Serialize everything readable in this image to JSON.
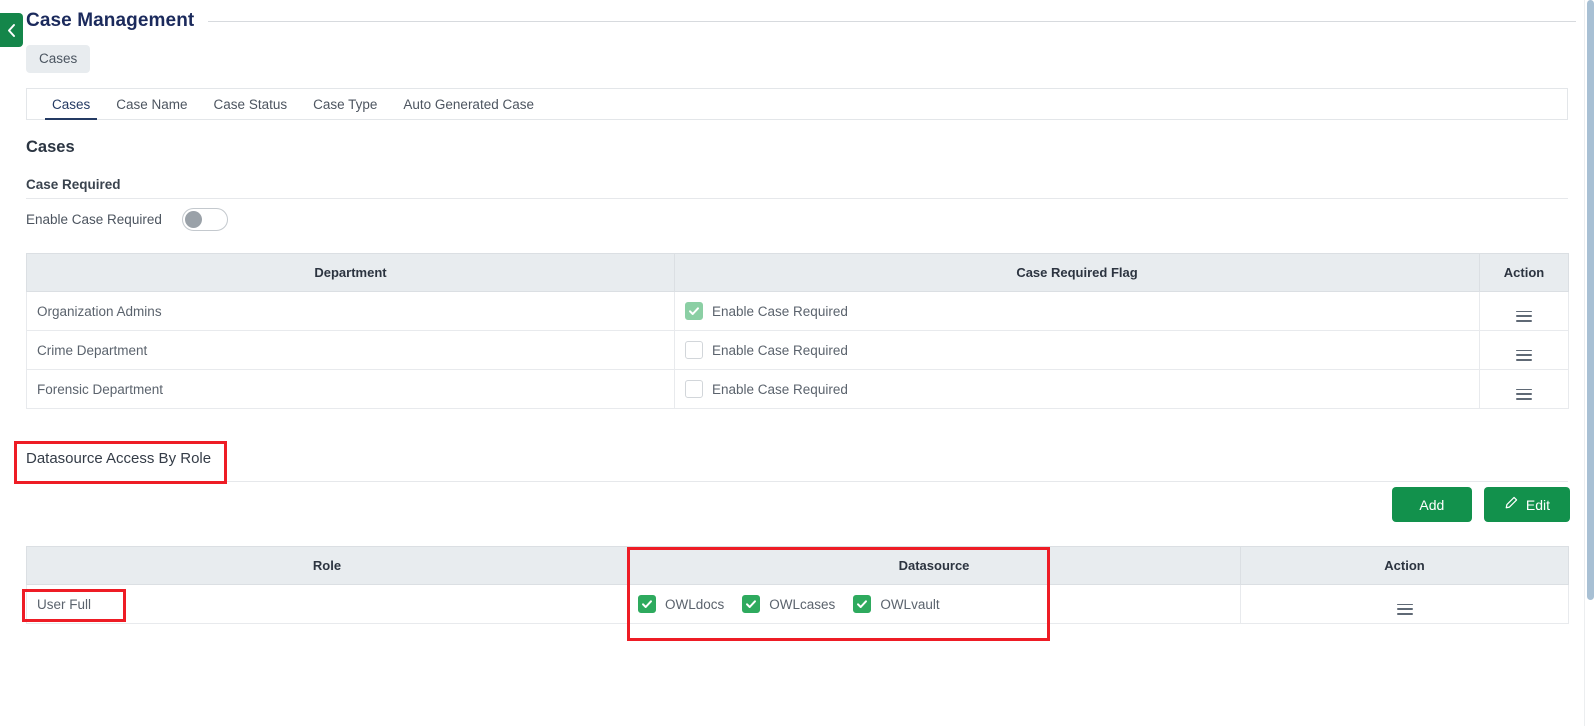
{
  "header": {
    "title": "Case Management",
    "back_icon": "chevron-left-icon",
    "accent_green": "#14864a",
    "title_color": "#1b2a5c"
  },
  "breadcrumb": {
    "items": [
      "Cases"
    ]
  },
  "tabs": [
    {
      "label": "Cases",
      "active": true
    },
    {
      "label": "Case Name",
      "active": false
    },
    {
      "label": "Case Status",
      "active": false
    },
    {
      "label": "Case Type",
      "active": false
    },
    {
      "label": "Auto Generated Case",
      "active": false
    }
  ],
  "cases_section": {
    "title": "Cases",
    "subtitle": "Case Required",
    "toggle": {
      "label": "Enable Case Required",
      "checked": false
    },
    "table": {
      "columns": [
        "Department",
        "Case Required Flag",
        "Action"
      ],
      "rows": [
        {
          "department": "Organization Admins",
          "flag_label": "Enable Case Required",
          "flag_checked": true,
          "action_icon": "hamburger-menu-icon"
        },
        {
          "department": "Crime Department",
          "flag_label": "Enable Case Required",
          "flag_checked": false,
          "action_icon": "hamburger-menu-icon"
        },
        {
          "department": "Forensic Department",
          "flag_label": "Enable Case Required",
          "flag_checked": false,
          "action_icon": "hamburger-menu-icon"
        }
      ]
    }
  },
  "datasource_section": {
    "title": "Datasource Access By Role",
    "buttons": [
      {
        "label": "Add",
        "icon": null,
        "color": "#12914c"
      },
      {
        "label": "Edit",
        "icon": "pencil-icon",
        "color": "#12914c"
      }
    ],
    "table": {
      "columns": [
        "Role",
        "Datasource",
        "Action"
      ],
      "rows": [
        {
          "role": "User Full",
          "datasources": [
            {
              "label": "OWLdocs",
              "checked": true
            },
            {
              "label": "OWLcases",
              "checked": true
            },
            {
              "label": "OWLvault",
              "checked": true
            }
          ],
          "action_icon": "hamburger-menu-icon"
        }
      ]
    }
  },
  "annotations": {
    "color": "#ee1c25",
    "boxes": [
      {
        "target": "datasource-section-title"
      },
      {
        "target": "role-cell-user-full"
      },
      {
        "target": "datasource-column"
      }
    ]
  }
}
